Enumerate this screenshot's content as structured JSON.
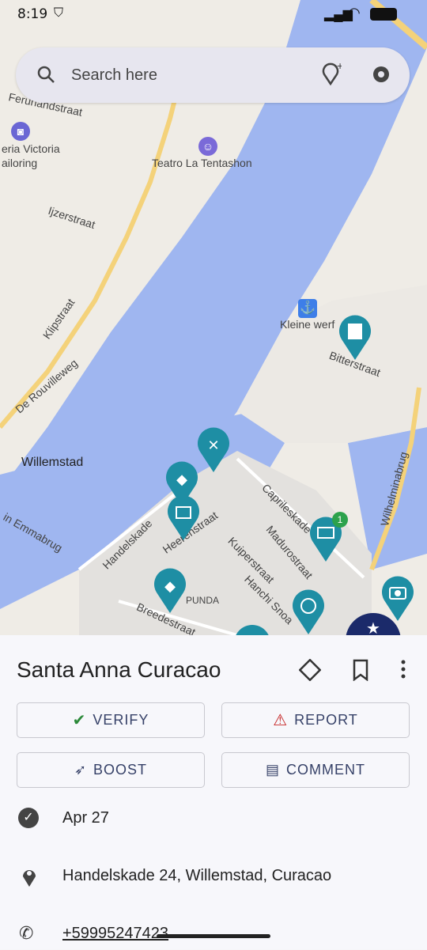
{
  "status": {
    "time": "8:19"
  },
  "search": {
    "placeholder": "Search here"
  },
  "map": {
    "labels": [
      {
        "text": "Ferunandstraat"
      },
      {
        "text": "eria Victoria"
      },
      {
        "text": "ailoring"
      },
      {
        "text": "Teatro La Tentashon"
      },
      {
        "text": "Ijzerstraat"
      },
      {
        "text": "Klipstraat"
      },
      {
        "text": "De Rouvilleweg"
      },
      {
        "text": "Willemstad"
      },
      {
        "text": "Kleine werf"
      },
      {
        "text": "Bitterstraat"
      },
      {
        "text": "Caprileskade"
      },
      {
        "text": "Handelskade"
      },
      {
        "text": "Heerenstraat"
      },
      {
        "text": "Kuiperstraat"
      },
      {
        "text": "Madurostraat"
      },
      {
        "text": "Hanchi Snoa"
      },
      {
        "text": "PUNDA"
      },
      {
        "text": "Breedestraat"
      },
      {
        "text": "Wilhelminabrug"
      },
      {
        "text": "in Emmabrug"
      }
    ],
    "badge_count": "1"
  },
  "place": {
    "title": "Santa Anna Curacao",
    "buttons": {
      "verify": "VERIFY",
      "report": "REPORT",
      "boost": "BOOST",
      "comment": "COMMENT"
    },
    "verified_date": "Apr 27",
    "address": "Handelskade 24, Willemstad, Curacao",
    "phone": "+59995247423"
  }
}
